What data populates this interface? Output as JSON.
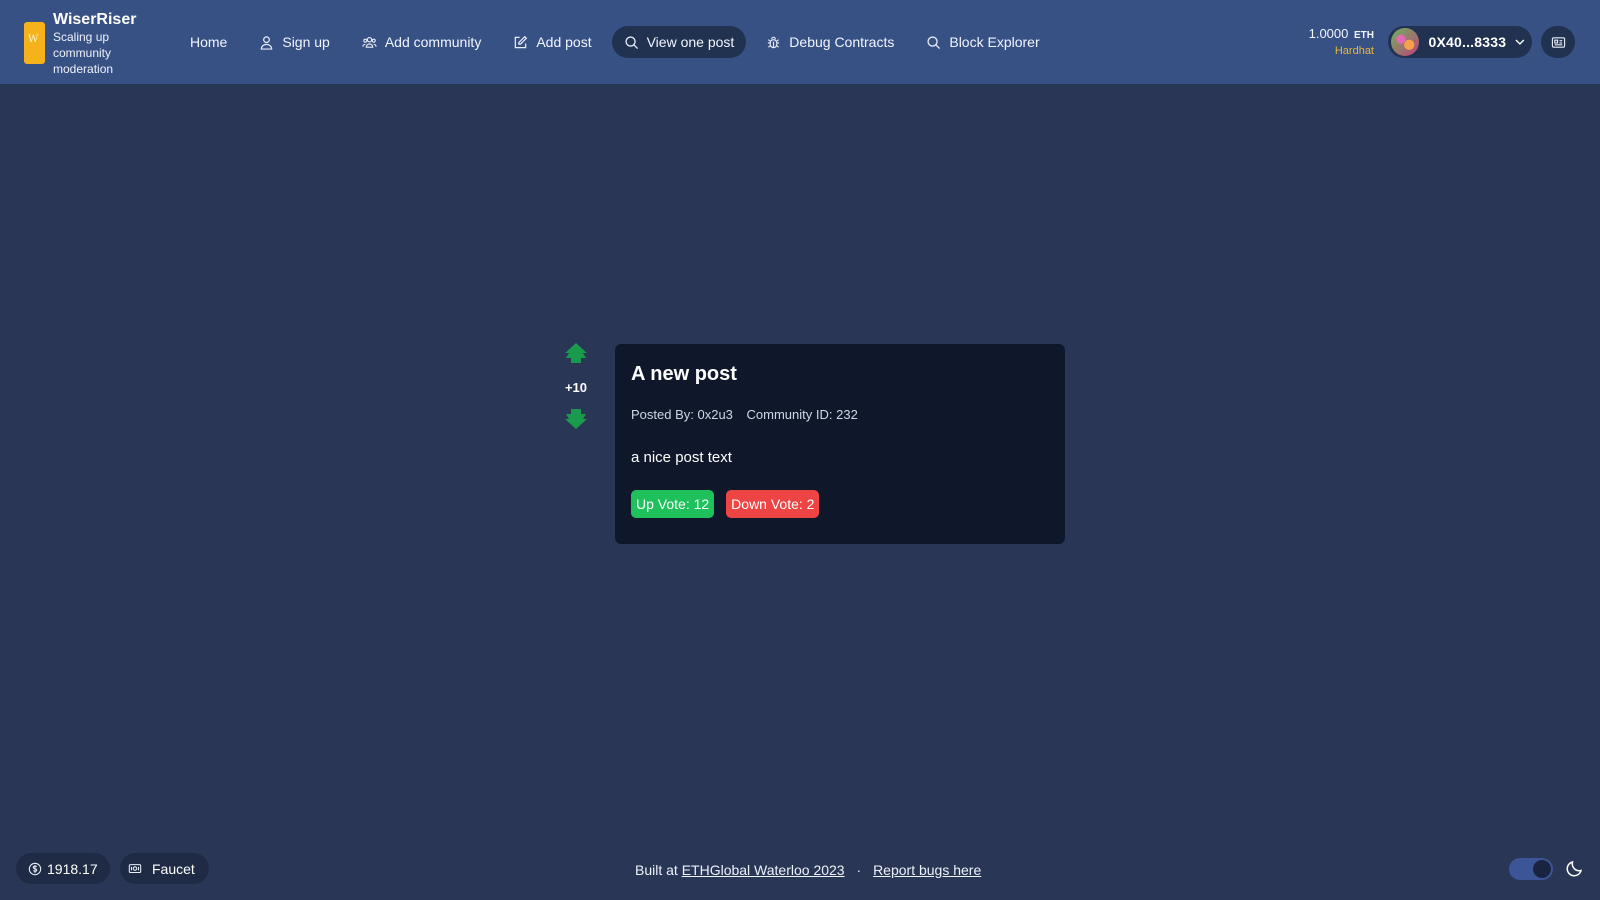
{
  "brand": {
    "name": "WiserRiser",
    "tagline": "Scaling up community moderation",
    "logo_letter": "W"
  },
  "nav": [
    {
      "label": "Home",
      "icon": "none"
    },
    {
      "label": "Sign up",
      "icon": "user-icon"
    },
    {
      "label": "Add community",
      "icon": "users-icon"
    },
    {
      "label": "Add post",
      "icon": "edit-icon"
    },
    {
      "label": "View one post",
      "icon": "search-icon",
      "active": true
    },
    {
      "label": "Debug Contracts",
      "icon": "bug-icon"
    },
    {
      "label": "Block Explorer",
      "icon": "search-icon"
    }
  ],
  "wallet": {
    "balance": "1.0000",
    "currency": "ETH",
    "network": "Hardhat",
    "address": "0X40...8333"
  },
  "post": {
    "score": "+10",
    "title": "A new post",
    "posted_by": "Posted By: 0x2u3",
    "community": "Community ID: 232",
    "body": "a nice post text",
    "up_vote": "Up Vote: 12",
    "down_vote": "Down Vote: 2"
  },
  "footer": {
    "price": "1918.17",
    "faucet": "Faucet",
    "built_at": "Built at",
    "built_link": "ETHGlobal Waterloo 2023",
    "separator": "·",
    "report": "Report bugs here"
  },
  "colors": {
    "background": "#2a3655",
    "header": "#385185",
    "card": "#0f182b",
    "upvote": "#1fc15d",
    "downvote": "#ef4444",
    "arrow": "#1a9a4c",
    "network": "#e6b738"
  }
}
